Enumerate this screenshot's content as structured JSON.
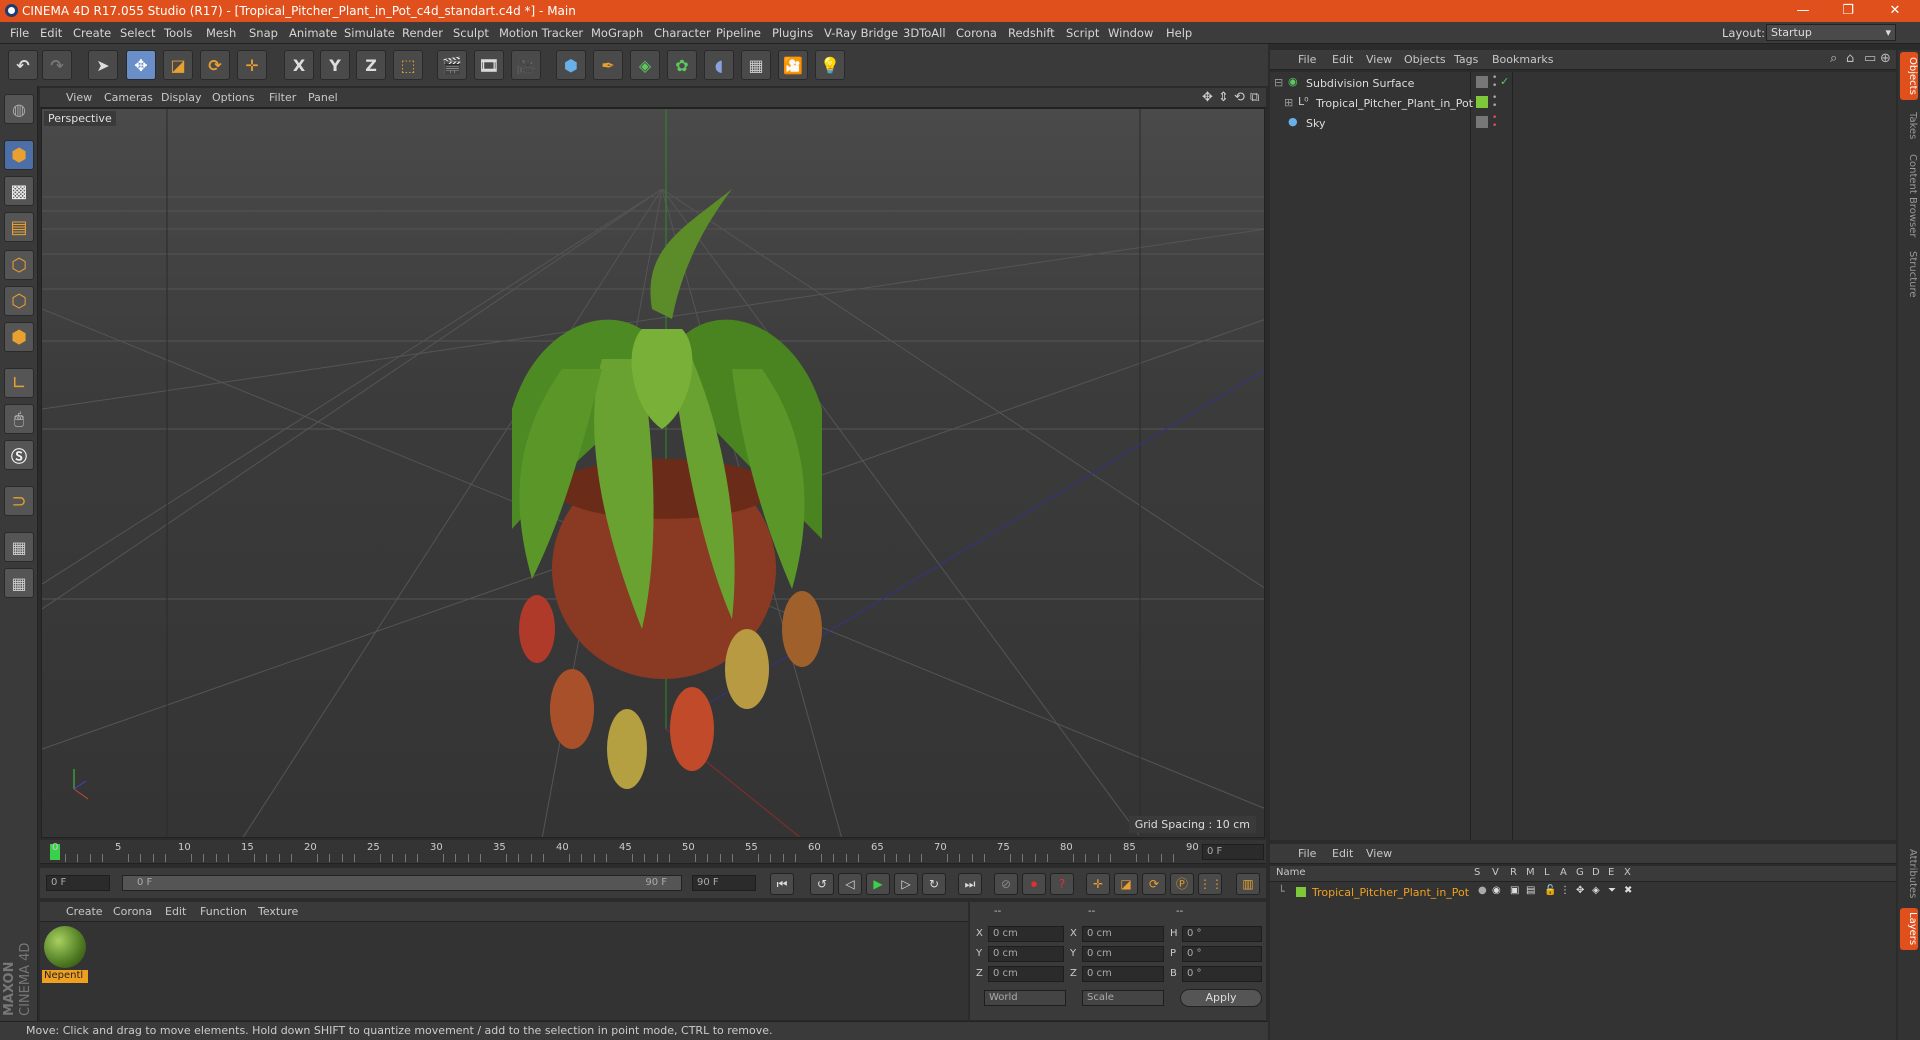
{
  "titlebar": {
    "title": "CINEMA 4D R17.055 Studio (R17) - [Tropical_Pitcher_Plant_in_Pot_c4d_standart.c4d *] - Main",
    "minimize": "—",
    "restore": "❐",
    "close": "✕"
  },
  "menubar": {
    "items": [
      "File",
      "Edit",
      "Create",
      "Select",
      "Tools",
      "Mesh",
      "Snap",
      "Animate",
      "Simulate",
      "Render",
      "Sculpt",
      "Motion Tracker",
      "MoGraph",
      "Character",
      "Pipeline",
      "Plugins",
      "V-Ray Bridge",
      "3DToAll",
      "Corona",
      "Redshift",
      "Script",
      "Window",
      "Help"
    ],
    "layout_label": "Layout:",
    "layout_value": "Startup"
  },
  "toolbar": {
    "axis_x": "X",
    "axis_y": "Y",
    "axis_z": "Z"
  },
  "viewport": {
    "menu": [
      "View",
      "Cameras",
      "Display",
      "Options",
      "Filter",
      "Panel"
    ],
    "label": "Perspective",
    "grid_spacing": "Grid Spacing : 10 cm"
  },
  "timeline": {
    "ticks": [
      "0",
      "5",
      "10",
      "15",
      "20",
      "25",
      "30",
      "35",
      "40",
      "45",
      "50",
      "55",
      "60",
      "65",
      "70",
      "75",
      "80",
      "85",
      "90"
    ],
    "current_frame": "0 F",
    "start_field": "0 F",
    "range_start": "0 F",
    "range_end": "90 F",
    "end_field": "90 F"
  },
  "material_manager": {
    "menu": [
      "Create",
      "Corona",
      "Edit",
      "Function",
      "Texture"
    ],
    "material_name": "Nepentl"
  },
  "coordinates": {
    "header": [
      "--",
      "--",
      "--"
    ],
    "rows": [
      {
        "a": "X",
        "av": "0 cm",
        "b": "X",
        "bv": "0 cm",
        "c": "H",
        "cv": "0 °"
      },
      {
        "a": "Y",
        "av": "0 cm",
        "b": "Y",
        "bv": "0 cm",
        "c": "P",
        "cv": "0 °"
      },
      {
        "a": "Z",
        "av": "0 cm",
        "b": "Z",
        "bv": "0 cm",
        "c": "B",
        "cv": "0 °"
      }
    ],
    "world": "World",
    "scale": "Scale",
    "apply": "Apply"
  },
  "status": {
    "text": "Move: Click and drag to move elements. Hold down SHIFT to quantize movement / add to the selection in point mode, CTRL to remove."
  },
  "object_manager": {
    "menu": [
      "File",
      "Edit",
      "View",
      "Objects",
      "Tags",
      "Bookmarks"
    ],
    "objects": [
      {
        "name": "Subdivision Surface"
      },
      {
        "name": "Tropical_Pitcher_Plant_in_Pot"
      },
      {
        "name": "Sky"
      }
    ]
  },
  "right_tabs": [
    "Objects",
    "Takes",
    "Content Browser",
    "Structure",
    "Attributes",
    "Layers"
  ],
  "layer_manager": {
    "menu": [
      "File",
      "Edit",
      "View"
    ],
    "columns": [
      "Name",
      "S",
      "V",
      "R",
      "M",
      "L",
      "A",
      "G",
      "D",
      "E",
      "X"
    ],
    "layer_name": "Tropical_Pitcher_Plant_in_Pot"
  },
  "branding": {
    "maxon": "MAXON",
    "cinema": "CINEMA 4D"
  },
  "colors": {
    "accent": "#e0501c",
    "selected_blue": "#4d6fa8",
    "layer_green": "#7ec83a",
    "layer_name_color": "#f0a020"
  }
}
